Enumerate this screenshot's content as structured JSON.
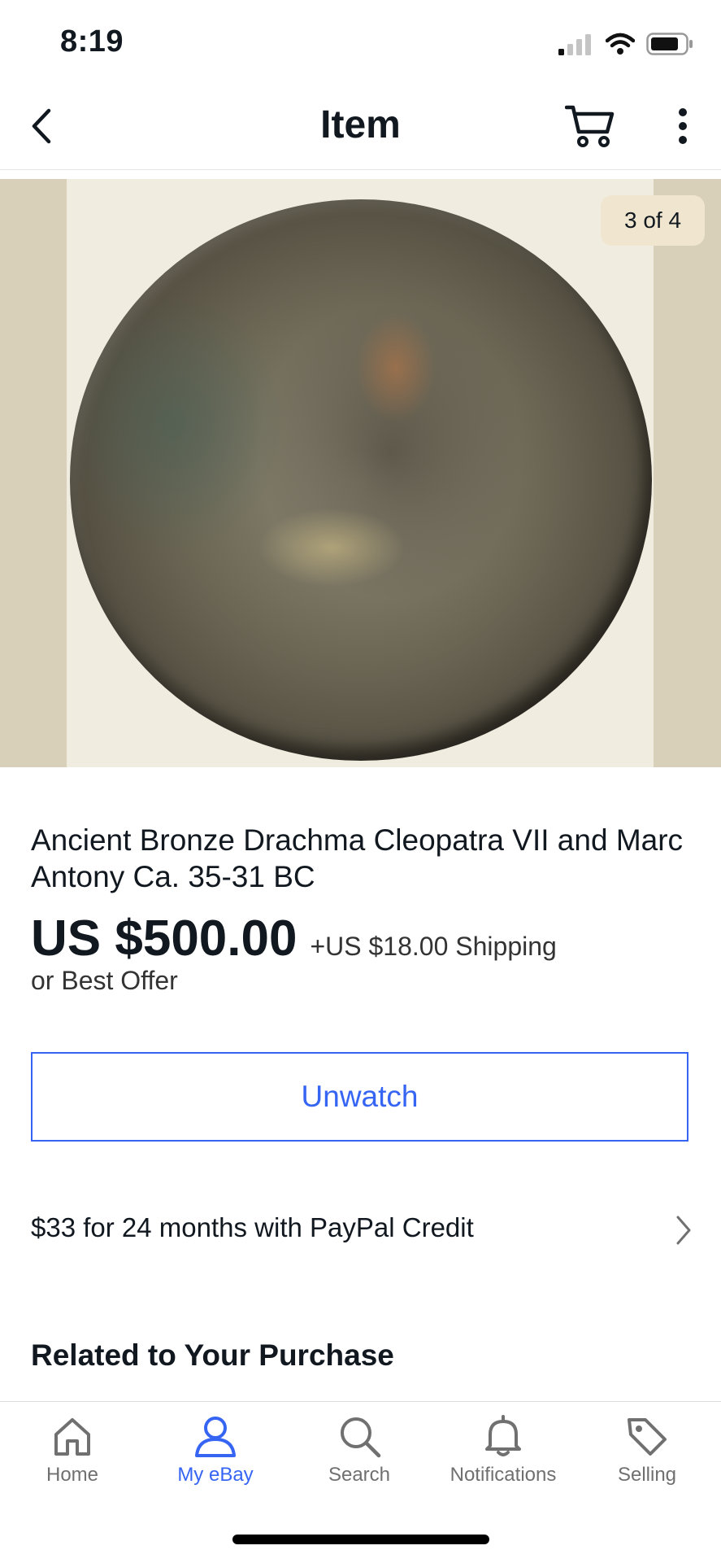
{
  "status_bar": {
    "time": "8:19"
  },
  "nav": {
    "title": "Item"
  },
  "gallery": {
    "counter": "3 of 4"
  },
  "item": {
    "title": "Ancient Bronze Drachma Cleopatra VII and Marc Antony Ca. 35-31 BC",
    "price": "US $500.00",
    "shipping": "+US $18.00 Shipping",
    "best_offer": "or Best Offer"
  },
  "actions": {
    "unwatch_label": "Unwatch"
  },
  "financing": {
    "text": "$33 for 24 months with PayPal Credit"
  },
  "related": {
    "heading": "Related to Your Purchase"
  },
  "tabs": [
    {
      "label": "Home",
      "icon": "home-icon",
      "active": false
    },
    {
      "label": "My eBay",
      "icon": "user-icon",
      "active": true
    },
    {
      "label": "Search",
      "icon": "search-icon",
      "active": false
    },
    {
      "label": "Notifications",
      "icon": "bell-icon",
      "active": false
    },
    {
      "label": "Selling",
      "icon": "tag-icon",
      "active": false
    }
  ],
  "colors": {
    "accent": "#3665f3",
    "text": "#111820",
    "muted": "#707070"
  }
}
